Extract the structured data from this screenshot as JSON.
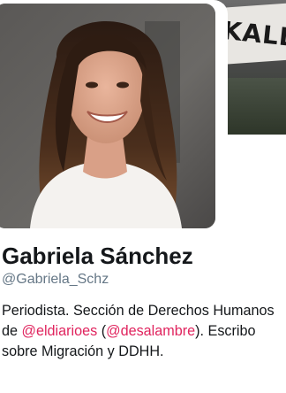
{
  "profile": {
    "name": "Gabriela Sánchez",
    "handle": "@Gabriela_Schz",
    "bio": {
      "text_1": "Periodista. Sección de Derechos Humanos de ",
      "mention_1": "@eldiarioes",
      "text_2": " (",
      "mention_2": "@desalambre",
      "text_3": "). Escribo sobre Migración y DDHH."
    }
  },
  "banner": {
    "sign_text": "KALL"
  },
  "colors": {
    "link": "#e0245e",
    "name": "#14171a",
    "handle": "#657786"
  },
  "icons": {
    "avatar": "profile-photo",
    "banner": "header-photo"
  }
}
